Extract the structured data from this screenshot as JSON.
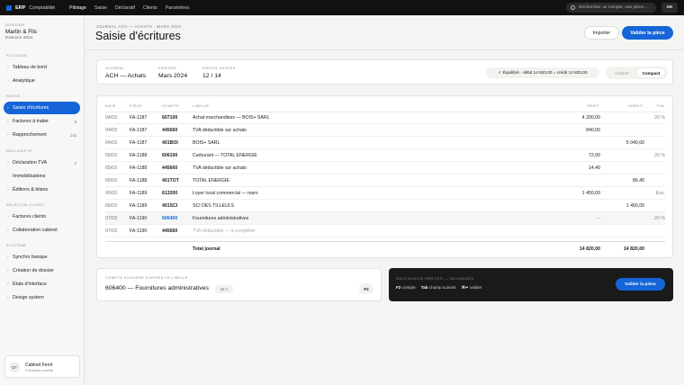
{
  "topbar": {
    "brand": "ERP",
    "brand_sub": "Comptabilité",
    "nav": [
      "Pilotage",
      "Saisie",
      "Déclaratif",
      "Clients",
      "Paramètres"
    ],
    "active_nav": "Pilotage",
    "search_placeholder": "Rechercher un compte, une pièce…",
    "user_initials": "AK",
    "accent": "#1565d8"
  },
  "sidebar": {
    "dossier_label": "DOSSIER",
    "dossier_name": "Martin & Fils",
    "exercice": "Exercice 2024",
    "sections": {
      "pilotage": "PILOTAGE",
      "saisie": "SAISIE",
      "declaratif": "DÉCLARATIF",
      "relation": "RELATION CLIENT",
      "systeme": "SYSTÈME"
    },
    "items": {
      "tableau": "Tableau de bord",
      "analytique": "Analytique",
      "saisie": "Saisie d'écritures",
      "factures": "Factures à traiter",
      "factures_count": "8",
      "rappro": "Rapprochement",
      "rappro_count": "142",
      "tva": "Déclaration TVA",
      "tva_count": "1",
      "immo": "Immobilisations",
      "editions": "Éditions & bilans",
      "factures_clients": "Factures clients",
      "collab": "Collaboration cabinet",
      "synchro": "Synchro banque",
      "creation": "Création de dossier",
      "etats": "États d'interface",
      "design": "Design system"
    },
    "cabinet": {
      "initials": "CF",
      "name": "Cabinet Ferré",
      "sub": "3 dossiers ouverts"
    }
  },
  "header": {
    "breadcrumb": "JOURNAL ACH — ACHATS · MARS 2024",
    "title": "Saisie d'écritures",
    "import_label": "Importer",
    "validate_label": "Valider la pièce"
  },
  "info": {
    "journal_label": "JOURNAL",
    "journal_value": "ACH — Achats",
    "periode_label": "PÉRIODE",
    "periode_value": "Mars 2024",
    "pieces_label": "PIÈCES SAISIES",
    "pieces_value": "12 / 14",
    "balance": "✓ Équilibré · débit 14 820,00 = crédit 14 820,00",
    "mode_confort": "Confort",
    "mode_compact": "Compact"
  },
  "table": {
    "headers": {
      "date": "DATE",
      "piece": "PIÈCE",
      "compte": "COMPTE",
      "libelle": "LIBELLÉ",
      "debit": "DÉBIT",
      "credit": "CRÉDIT",
      "tva": "TVA"
    },
    "rows": [
      {
        "date": "04/03",
        "piece": "FA-1187",
        "compte": "607100",
        "libelle": "Achat marchandises — BOIS+ SARL",
        "debit": "4 200,00",
        "credit": "",
        "tva": "20 %"
      },
      {
        "date": "04/03",
        "piece": "FA-1187",
        "compte": "445660",
        "libelle": "TVA déductible sur achats",
        "debit": "840,00",
        "credit": "",
        "tva": ""
      },
      {
        "date": "04/03",
        "piece": "FA-1187",
        "compte": "401BOI",
        "libelle": "BOIS+ SARL",
        "debit": "",
        "credit": "5 040,00",
        "tva": ""
      },
      {
        "date": "05/03",
        "piece": "FA-1188",
        "compte": "606100",
        "libelle": "Carburant — TOTAL ENERGIE",
        "debit": "72,00",
        "credit": "",
        "tva": "20 %"
      },
      {
        "date": "05/03",
        "piece": "FA-1188",
        "compte": "445660",
        "libelle": "TVA déductible sur achats",
        "debit": "14,40",
        "credit": "",
        "tva": ""
      },
      {
        "date": "05/03",
        "piece": "FA-1188",
        "compte": "401TOT",
        "libelle": "TOTAL ENERGIE",
        "debit": "",
        "credit": "86,40",
        "tva": ""
      },
      {
        "date": "06/03",
        "piece": "FA-1189",
        "compte": "613200",
        "libelle": "Loyer local commercial — mars",
        "debit": "1 450,00",
        "credit": "",
        "tva": "Exo."
      },
      {
        "date": "06/03",
        "piece": "FA-1189",
        "compte": "401SCI",
        "libelle": "SCI DES TILLEULS",
        "debit": "",
        "credit": "1 450,00",
        "tva": ""
      },
      {
        "date": "07/03",
        "piece": "FA-1190",
        "compte": "606400",
        "libelle": "Fournitures administratives",
        "debit": "—",
        "credit": "",
        "tva": "20 %"
      },
      {
        "date": "07/03",
        "piece": "FA-1190",
        "compte": "445660",
        "libelle": "TVA déductible — à compléter",
        "debit": "",
        "credit": "",
        "tva": ""
      }
    ],
    "total_label": "Total journal",
    "total_debit": "14 820,00",
    "total_credit": "14 820,00"
  },
  "suggestion": {
    "label": "COMPTE SUGGÉRÉ D'APRÈS LE LIBELLÉ",
    "value": "606400 — Fournitures administratives",
    "badge": "34 ×",
    "key": "F2"
  },
  "shortcuts": {
    "label": "RACCOURCIS HÉRITÉS — INCHANGÉS",
    "k1": "F2",
    "k1_txt": "compte",
    "k2": "Tab",
    "k2_txt": "champ suivant",
    "k3": "⌘↵",
    "k3_txt": "valider",
    "button": "Valider la pièce"
  }
}
